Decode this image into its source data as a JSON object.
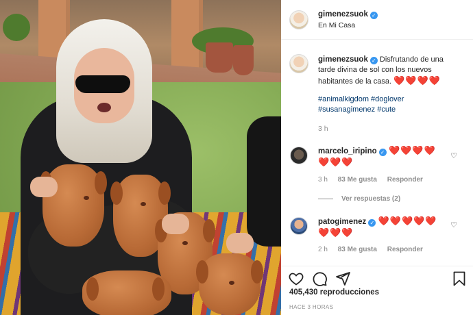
{
  "post_header": {
    "username": "gimenezsuok",
    "location": "En Mi Casa"
  },
  "caption": {
    "username": "gimenezsuok",
    "text": "Disfrutando de una tarde divina de sol con los nuevos habitantes de la casa.",
    "emojis": "❤️❤️❤️❤️",
    "hashtags": [
      "#animalkigdom",
      "#doglover",
      "#susanagimenez",
      "#cute"
    ],
    "time": "3 h"
  },
  "comments": [
    {
      "username": "marcelo_iripino",
      "emojis_line1": "❤️❤️❤️❤️",
      "emojis_line2": "❤️❤️❤️",
      "time": "3 h",
      "likes": "83 Me gusta",
      "reply_label": "Responder",
      "view_replies": "Ver respuestas (2)"
    },
    {
      "username": "patogimenez",
      "emojis_line1": "❤️❤️❤️❤️❤️",
      "emojis_line2": "❤️❤️❤️",
      "time": "2 h",
      "likes": "83 Me gusta",
      "reply_label": "Responder"
    }
  ],
  "actions": {
    "icons": [
      "heart-icon",
      "comment-icon",
      "share-icon",
      "bookmark-icon"
    ],
    "views": "405,430 reproducciones",
    "time_ago": "HACE 3 HORAS"
  },
  "colors": {
    "verified": "#3897f0",
    "heart": "#ed2d3d",
    "hashtag": "#00376b",
    "muted": "#8e8e8e"
  }
}
